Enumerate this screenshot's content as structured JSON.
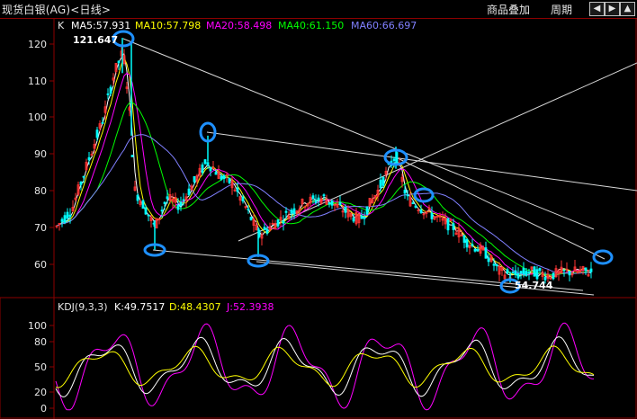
{
  "window": {
    "title": "现货白银(AG)<日线>",
    "menu": {
      "overlay": "商品叠加",
      "period": "周期"
    },
    "nav_icons": [
      "arrow-left-icon",
      "arrow-right-icon",
      "arrow-up-icon"
    ]
  },
  "price_panel": {
    "indicator_label": "K",
    "ma": [
      {
        "label": "MA5:57.931",
        "color": "#ffffff"
      },
      {
        "label": "MA10:57.798",
        "color": "#ffff00"
      },
      {
        "label": "MA20:58.498",
        "color": "#ff00ff"
      },
      {
        "label": "MA40:61.150",
        "color": "#00ff00"
      },
      {
        "label": "MA60:66.697",
        "color": "#8080ff"
      }
    ],
    "y_ticks": [
      "120",
      "110",
      "100",
      "90",
      "80",
      "70",
      "60"
    ],
    "high_label": "121.647",
    "low_label": "54.744"
  },
  "kdj_panel": {
    "title": "KDJ(9,3,3)",
    "k": "K:49.7517",
    "d": "D:48.4307",
    "j": "J:52.3938",
    "colors": {
      "k": "#ffffff",
      "d": "#ffff00",
      "j": "#ff00ff"
    },
    "y_ticks": [
      "100",
      "80",
      "50",
      "20",
      "0"
    ]
  },
  "colors": {
    "up": "#ff3333",
    "down": "#00ffff",
    "axis": "#8b0000",
    "marker": "#1e90ff"
  }
}
